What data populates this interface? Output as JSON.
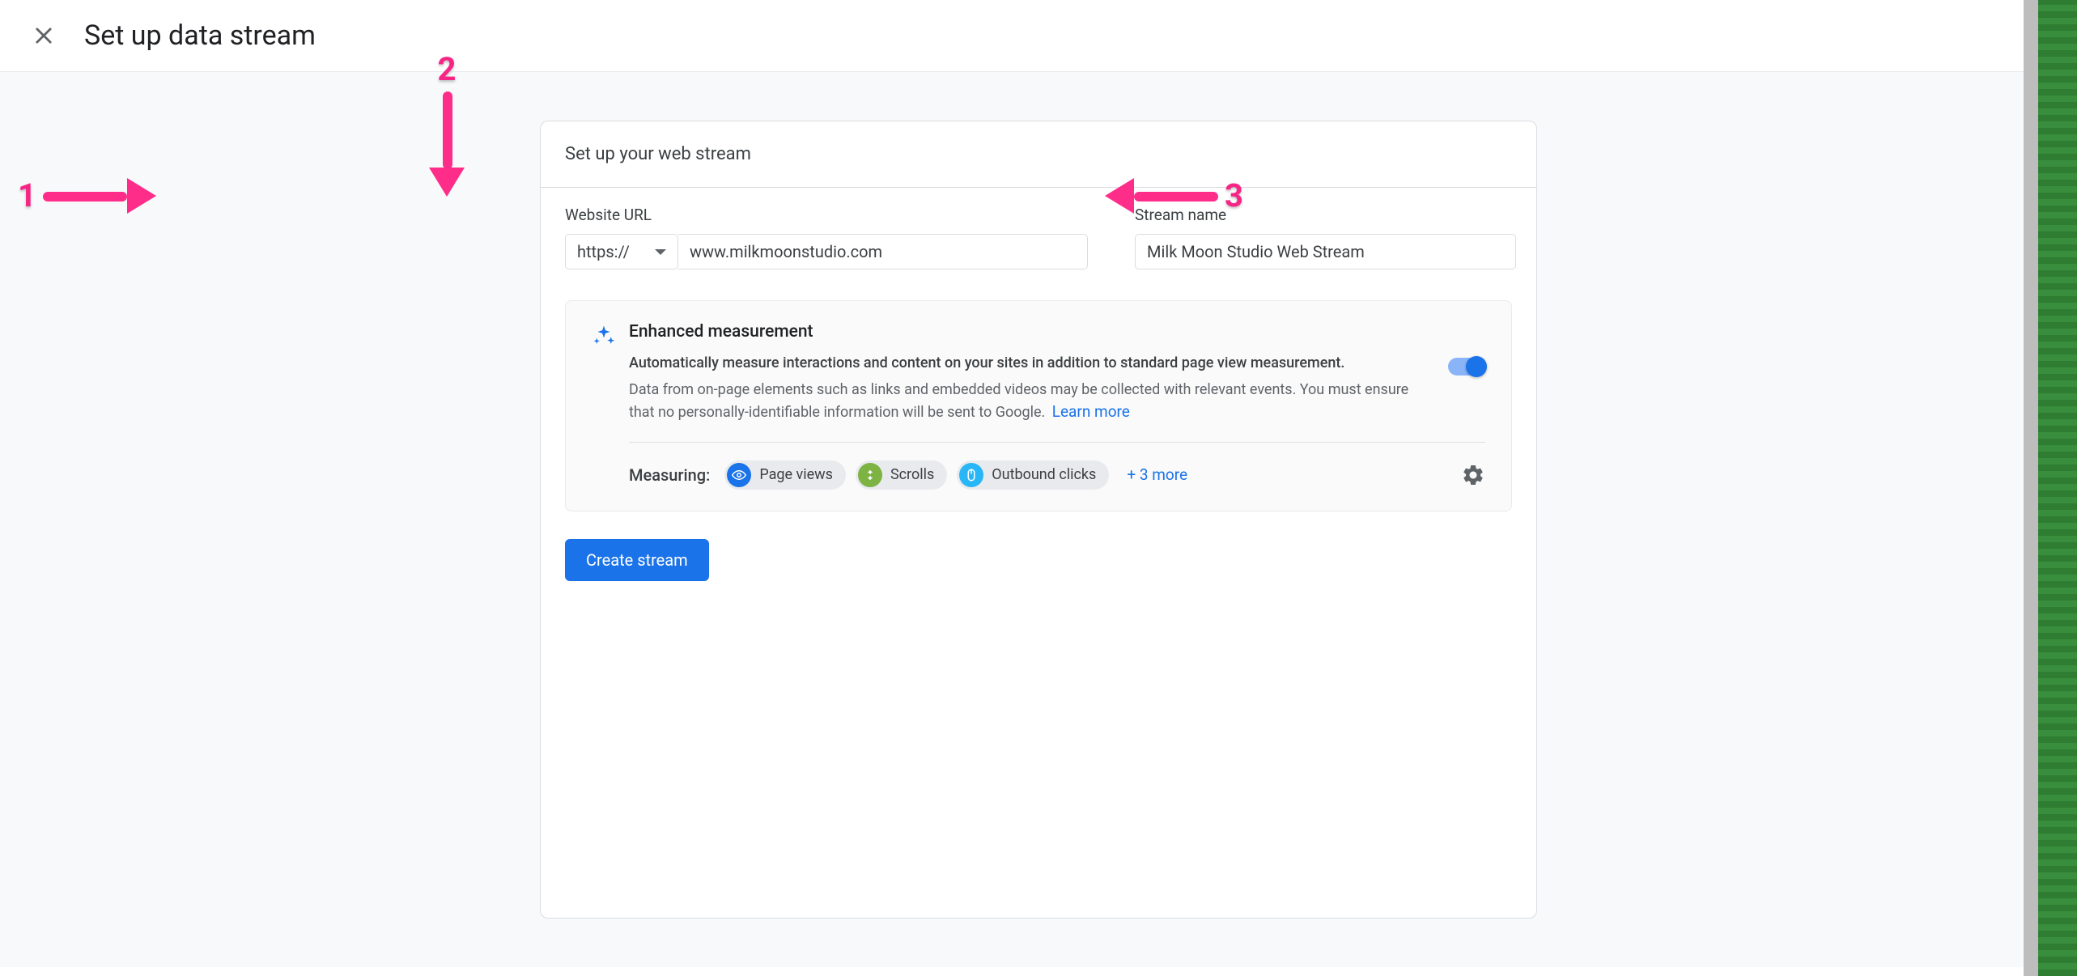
{
  "header": {
    "title": "Set up data stream"
  },
  "card": {
    "title": "Set up your web stream"
  },
  "fields": {
    "url_label": "Website URL",
    "protocol": "https://",
    "url_value": "www.milkmoonstudio.com",
    "stream_label": "Stream name",
    "stream_value": "Milk Moon Studio Web Stream"
  },
  "enhanced": {
    "title": "Enhanced measurement",
    "sub1": "Automatically measure interactions and content on your sites in addition to standard page view measurement.",
    "sub2": "Data from on-page elements such as links and embedded videos may be collected with relevant events. You must ensure that no personally-identifiable information will be sent to Google.",
    "learn_more": "Learn more"
  },
  "measuring": {
    "label": "Measuring:",
    "pills": {
      "0": "Page views",
      "1": "Scrolls",
      "2": "Outbound clicks"
    },
    "more": "+ 3 more"
  },
  "buttons": {
    "create": "Create stream"
  },
  "annotations": {
    "one": "1",
    "two": "2",
    "three": "3"
  }
}
